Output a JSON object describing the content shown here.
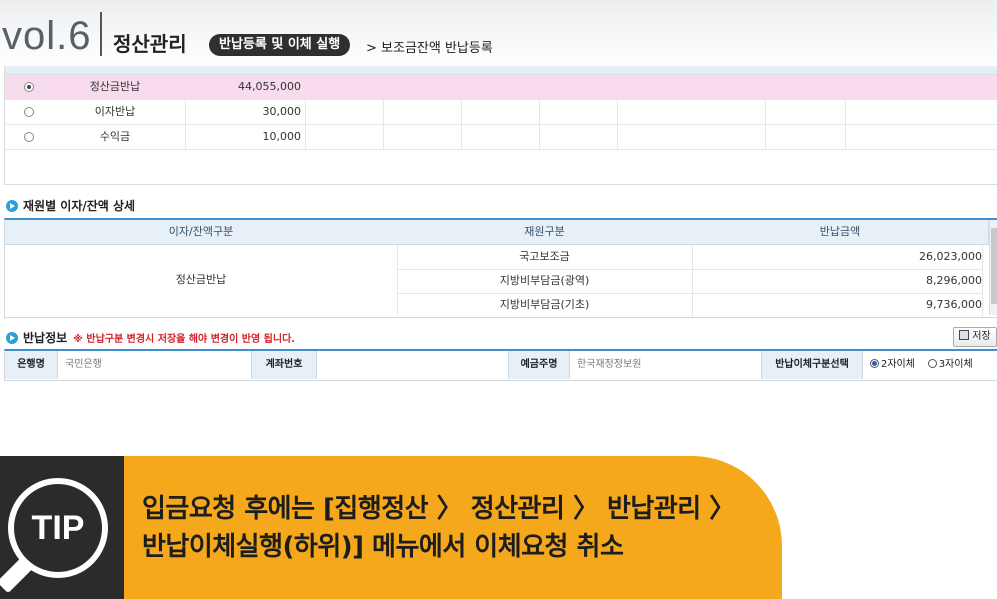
{
  "header": {
    "vol": "vol.6",
    "title": "정산관리",
    "pill": "반납등록 및 이체 실행",
    "breadcrumb": "> 보조금잔액 반납등록"
  },
  "top_table": {
    "rows": [
      {
        "selected": true,
        "name": "정산금반납",
        "amount": "44,055,000"
      },
      {
        "selected": false,
        "name": "이자반납",
        "amount": "30,000"
      },
      {
        "selected": false,
        "name": "수익금",
        "amount": "10,000"
      }
    ]
  },
  "detail": {
    "section_title": "재원별 이자/잔액 상세",
    "headers": [
      "이자/잔액구분",
      "재원구분",
      "반납금액"
    ],
    "group": "정산금반납",
    "rows": [
      {
        "source": "국고보조금",
        "amount": "26,023,000"
      },
      {
        "source": "지방비부담금(광역)",
        "amount": "8,296,000"
      },
      {
        "source": "지방비부담금(기초)",
        "amount": "9,736,000"
      }
    ]
  },
  "refund_info": {
    "section_title": "반납정보",
    "warning": "※ 반납구분 변경시 저장을 해야 변경이 반영 됩니다.",
    "save_label": "저장",
    "bank_label": "은행명",
    "bank_value": "국민은행",
    "account_label": "계좌번호",
    "account_value": "",
    "holder_label": "예금주명",
    "holder_value": "한국재정정보원",
    "transfer_label": "반납이체구분선택",
    "option_2": "2자이체",
    "option_3": "3자이체",
    "selected_option": "2자이체"
  },
  "tip": {
    "badge": "TIP",
    "line1": "입금요청 후에는 [집행정산 〉 정산관리 〉 반납관리 〉",
    "line2": "반납이체실행(하위)] 메뉴에서 이체요청 취소"
  }
}
